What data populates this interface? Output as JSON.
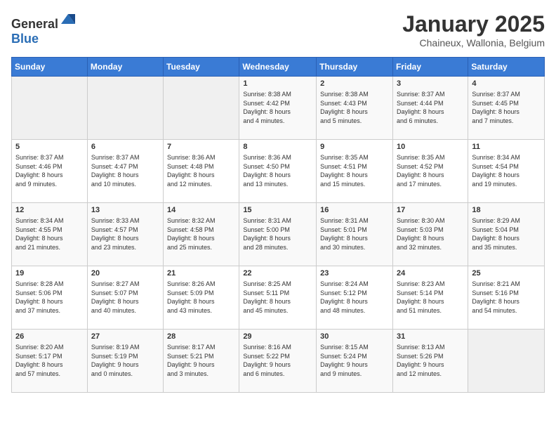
{
  "header": {
    "logo_general": "General",
    "logo_blue": "Blue",
    "month": "January 2025",
    "location": "Chaineux, Wallonia, Belgium"
  },
  "weekdays": [
    "Sunday",
    "Monday",
    "Tuesday",
    "Wednesday",
    "Thursday",
    "Friday",
    "Saturday"
  ],
  "weeks": [
    [
      {
        "day": "",
        "info": ""
      },
      {
        "day": "",
        "info": ""
      },
      {
        "day": "",
        "info": ""
      },
      {
        "day": "1",
        "info": "Sunrise: 8:38 AM\nSunset: 4:42 PM\nDaylight: 8 hours\nand 4 minutes."
      },
      {
        "day": "2",
        "info": "Sunrise: 8:38 AM\nSunset: 4:43 PM\nDaylight: 8 hours\nand 5 minutes."
      },
      {
        "day": "3",
        "info": "Sunrise: 8:37 AM\nSunset: 4:44 PM\nDaylight: 8 hours\nand 6 minutes."
      },
      {
        "day": "4",
        "info": "Sunrise: 8:37 AM\nSunset: 4:45 PM\nDaylight: 8 hours\nand 7 minutes."
      }
    ],
    [
      {
        "day": "5",
        "info": "Sunrise: 8:37 AM\nSunset: 4:46 PM\nDaylight: 8 hours\nand 9 minutes."
      },
      {
        "day": "6",
        "info": "Sunrise: 8:37 AM\nSunset: 4:47 PM\nDaylight: 8 hours\nand 10 minutes."
      },
      {
        "day": "7",
        "info": "Sunrise: 8:36 AM\nSunset: 4:48 PM\nDaylight: 8 hours\nand 12 minutes."
      },
      {
        "day": "8",
        "info": "Sunrise: 8:36 AM\nSunset: 4:50 PM\nDaylight: 8 hours\nand 13 minutes."
      },
      {
        "day": "9",
        "info": "Sunrise: 8:35 AM\nSunset: 4:51 PM\nDaylight: 8 hours\nand 15 minutes."
      },
      {
        "day": "10",
        "info": "Sunrise: 8:35 AM\nSunset: 4:52 PM\nDaylight: 8 hours\nand 17 minutes."
      },
      {
        "day": "11",
        "info": "Sunrise: 8:34 AM\nSunset: 4:54 PM\nDaylight: 8 hours\nand 19 minutes."
      }
    ],
    [
      {
        "day": "12",
        "info": "Sunrise: 8:34 AM\nSunset: 4:55 PM\nDaylight: 8 hours\nand 21 minutes."
      },
      {
        "day": "13",
        "info": "Sunrise: 8:33 AM\nSunset: 4:57 PM\nDaylight: 8 hours\nand 23 minutes."
      },
      {
        "day": "14",
        "info": "Sunrise: 8:32 AM\nSunset: 4:58 PM\nDaylight: 8 hours\nand 25 minutes."
      },
      {
        "day": "15",
        "info": "Sunrise: 8:31 AM\nSunset: 5:00 PM\nDaylight: 8 hours\nand 28 minutes."
      },
      {
        "day": "16",
        "info": "Sunrise: 8:31 AM\nSunset: 5:01 PM\nDaylight: 8 hours\nand 30 minutes."
      },
      {
        "day": "17",
        "info": "Sunrise: 8:30 AM\nSunset: 5:03 PM\nDaylight: 8 hours\nand 32 minutes."
      },
      {
        "day": "18",
        "info": "Sunrise: 8:29 AM\nSunset: 5:04 PM\nDaylight: 8 hours\nand 35 minutes."
      }
    ],
    [
      {
        "day": "19",
        "info": "Sunrise: 8:28 AM\nSunset: 5:06 PM\nDaylight: 8 hours\nand 37 minutes."
      },
      {
        "day": "20",
        "info": "Sunrise: 8:27 AM\nSunset: 5:07 PM\nDaylight: 8 hours\nand 40 minutes."
      },
      {
        "day": "21",
        "info": "Sunrise: 8:26 AM\nSunset: 5:09 PM\nDaylight: 8 hours\nand 43 minutes."
      },
      {
        "day": "22",
        "info": "Sunrise: 8:25 AM\nSunset: 5:11 PM\nDaylight: 8 hours\nand 45 minutes."
      },
      {
        "day": "23",
        "info": "Sunrise: 8:24 AM\nSunset: 5:12 PM\nDaylight: 8 hours\nand 48 minutes."
      },
      {
        "day": "24",
        "info": "Sunrise: 8:23 AM\nSunset: 5:14 PM\nDaylight: 8 hours\nand 51 minutes."
      },
      {
        "day": "25",
        "info": "Sunrise: 8:21 AM\nSunset: 5:16 PM\nDaylight: 8 hours\nand 54 minutes."
      }
    ],
    [
      {
        "day": "26",
        "info": "Sunrise: 8:20 AM\nSunset: 5:17 PM\nDaylight: 8 hours\nand 57 minutes."
      },
      {
        "day": "27",
        "info": "Sunrise: 8:19 AM\nSunset: 5:19 PM\nDaylight: 9 hours\nand 0 minutes."
      },
      {
        "day": "28",
        "info": "Sunrise: 8:17 AM\nSunset: 5:21 PM\nDaylight: 9 hours\nand 3 minutes."
      },
      {
        "day": "29",
        "info": "Sunrise: 8:16 AM\nSunset: 5:22 PM\nDaylight: 9 hours\nand 6 minutes."
      },
      {
        "day": "30",
        "info": "Sunrise: 8:15 AM\nSunset: 5:24 PM\nDaylight: 9 hours\nand 9 minutes."
      },
      {
        "day": "31",
        "info": "Sunrise: 8:13 AM\nSunset: 5:26 PM\nDaylight: 9 hours\nand 12 minutes."
      },
      {
        "day": "",
        "info": ""
      }
    ]
  ]
}
